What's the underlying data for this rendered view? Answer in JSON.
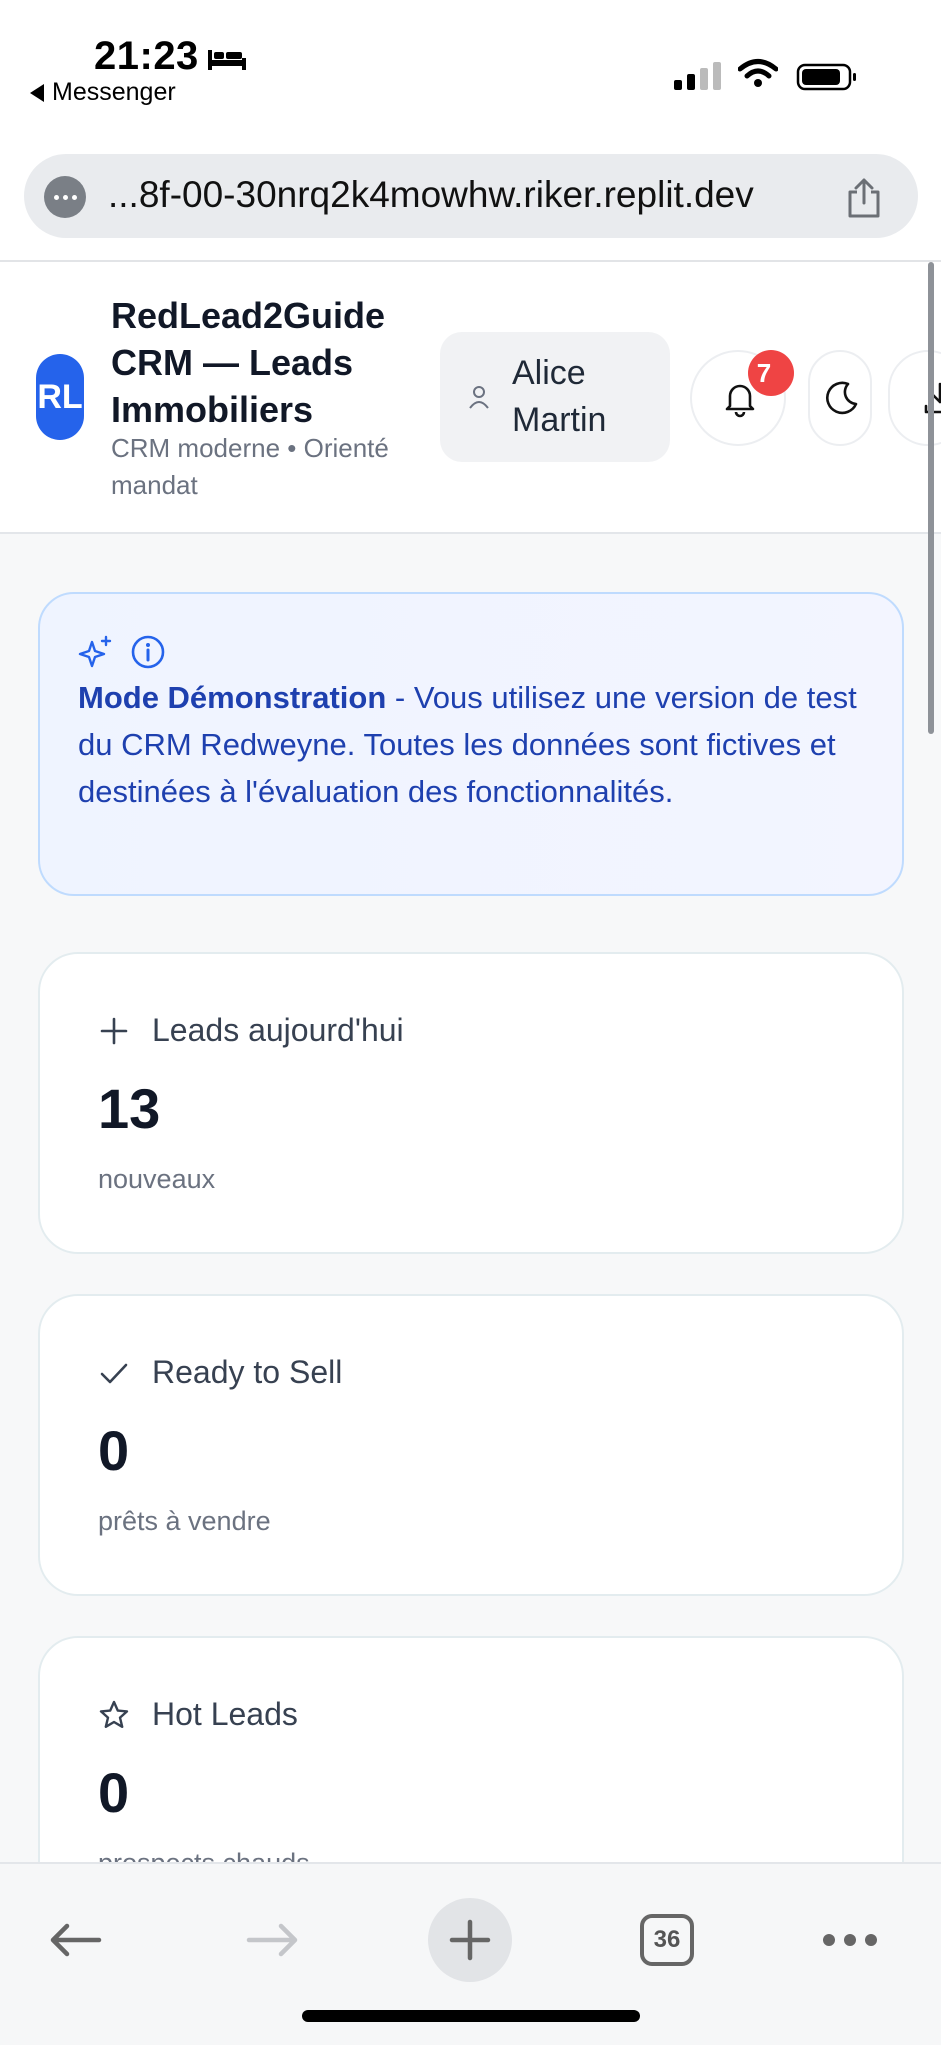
{
  "status_bar": {
    "time": "21:23",
    "back_app": "Messenger",
    "icons": [
      "bed-icon",
      "signal-icon",
      "wifi-icon",
      "battery-icon"
    ]
  },
  "browser": {
    "url": "...8f-00-30nrq2k4mowhw.riker.replit.dev",
    "toolbar": {
      "tab_count": "36"
    }
  },
  "header": {
    "logo_text": "RL",
    "title": "RedLead2Guide CRM — Leads Immobiliers",
    "subtitle": "CRM moderne • Orienté mandat",
    "user_name": "Alice Martin",
    "notification_count": "7"
  },
  "demo_banner": {
    "bold": "Mode Démonstration",
    "text": " - Vous utilisez une version de test du CRM Redweyne. Toutes les données sont fictives et destinées à l'évaluation des fonctionnalités."
  },
  "stats": [
    {
      "icon": "plus-icon",
      "label": "Leads aujourd'hui",
      "value": "13",
      "sub": "nouveaux"
    },
    {
      "icon": "check-icon",
      "label": "Ready to Sell",
      "value": "0",
      "sub": "prêts à vendre"
    },
    {
      "icon": "star-icon",
      "label": "Hot Leads",
      "value": "0",
      "sub": "prospects chauds"
    }
  ],
  "colors": {
    "accent": "#2563eb",
    "badge": "#ef4444",
    "banner_text": "#1e40af",
    "banner_border": "#bfdbfe"
  }
}
